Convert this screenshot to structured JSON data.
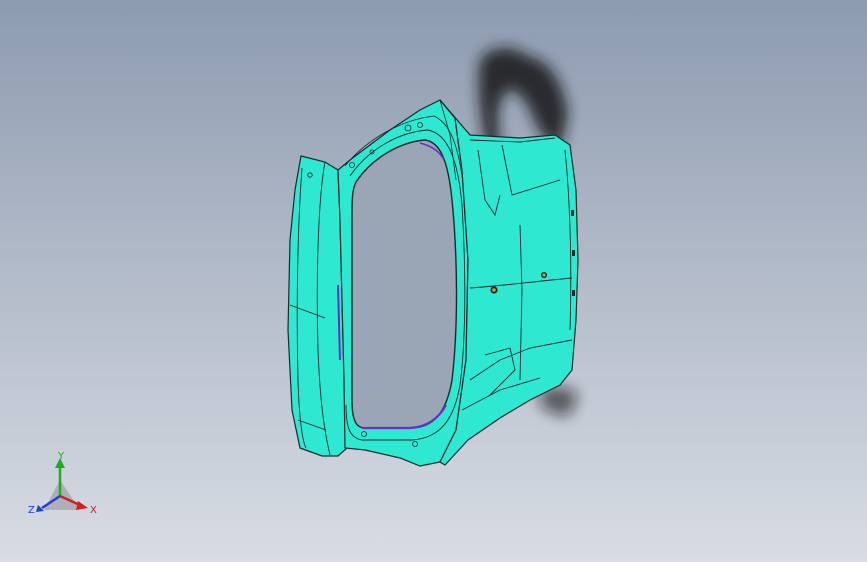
{
  "viewport": {
    "background_top": "#8d9bb0",
    "background_bottom": "#d8dce4"
  },
  "model": {
    "face_color": "#2ee8d2",
    "edge_color": "#1a2a2a",
    "inner_seal_color": "#6a2fc0",
    "shadow_color": "#141414"
  },
  "triad": {
    "y_label": "Y",
    "x_label": "X",
    "z_label": "Z",
    "y_color": "#22aa22",
    "x_color": "#d22020",
    "z_color": "#2040d0"
  }
}
